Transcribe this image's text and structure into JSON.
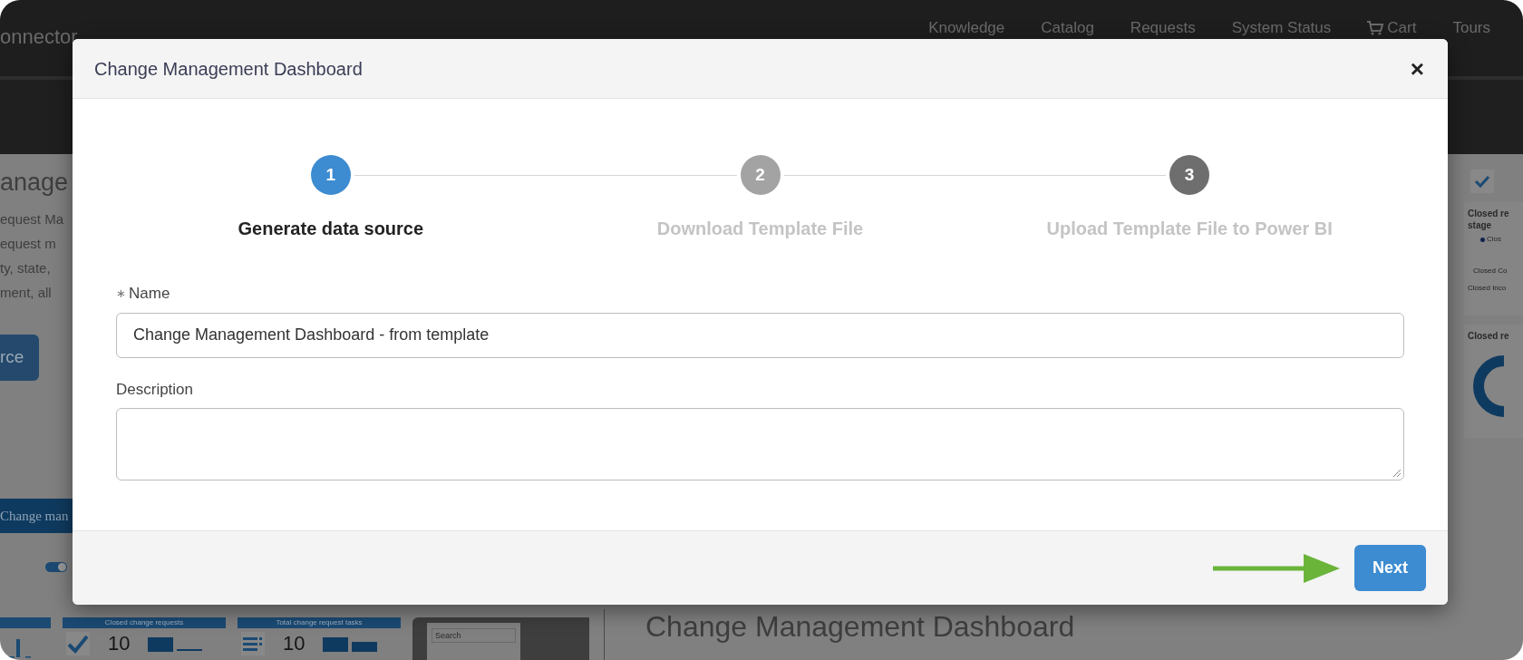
{
  "nav": {
    "brand": "onnector",
    "links": [
      {
        "label": "Knowledge",
        "kind": "text"
      },
      {
        "label": "Catalog",
        "kind": "text"
      },
      {
        "label": "Requests",
        "kind": "text"
      },
      {
        "label": "System Status",
        "kind": "text"
      },
      {
        "label": "Cart",
        "kind": "cart"
      },
      {
        "label": "Tours",
        "kind": "text"
      }
    ]
  },
  "background": {
    "heading": "anage",
    "lines": [
      "equest Ma",
      "equest m",
      "ty, state,",
      "ment, all"
    ],
    "button": "rce",
    "banner": "Change man",
    "toggle": {
      "on": true
    },
    "tiles": [
      {
        "title": "Closed change requests",
        "value": "10",
        "kind": "check"
      },
      {
        "title": "Total change request tasks",
        "value": "10",
        "kind": "list"
      }
    ],
    "search_placeholder": "Search",
    "right_cards": [
      {
        "title": "Closed re",
        "subtitle": "stage",
        "legend": "Clos",
        "labels": [
          "Closed Co",
          "Closed Inco"
        ]
      },
      {
        "title": "Closed re"
      }
    ],
    "dashboard_title": "Change Management Dashboard"
  },
  "dialog": {
    "title": "Change Management Dashboard",
    "close": "×",
    "steps": [
      {
        "number": "1",
        "label": "Generate data source",
        "selected": true,
        "color": "#3d8bd0"
      },
      {
        "number": "2",
        "label": "Download Template File",
        "selected": false,
        "color": "#a3a3a3"
      },
      {
        "number": "3",
        "label": "Upload Template File to Power BI",
        "selected": false,
        "color": "#6e6e6e"
      }
    ],
    "fields": [
      {
        "marker": "∗",
        "label": "Name",
        "kind": "input",
        "value": "Change Management Dashboard - from template"
      },
      {
        "label": "Description",
        "kind": "textarea"
      }
    ],
    "button": "Next"
  }
}
